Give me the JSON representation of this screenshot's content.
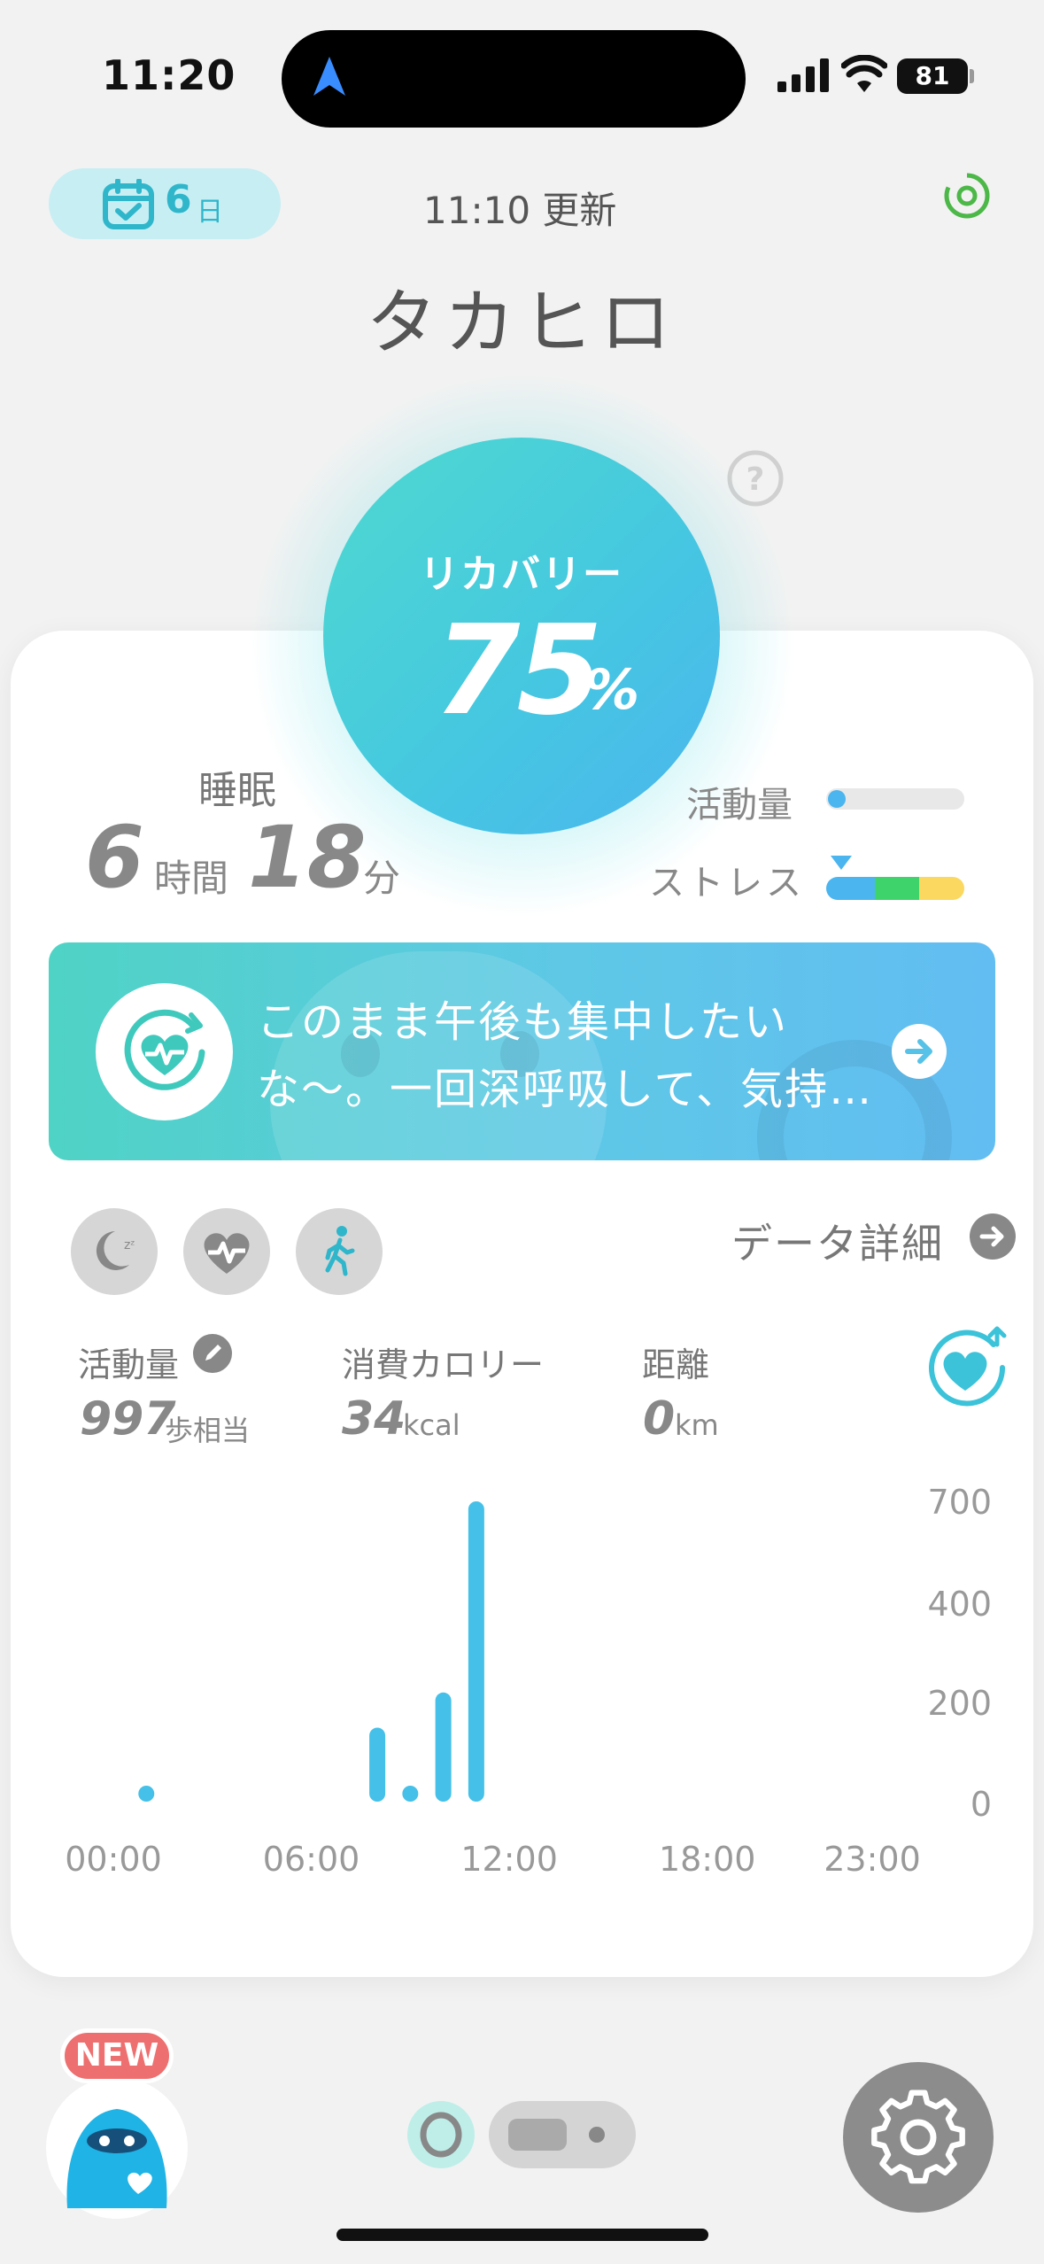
{
  "status_bar": {
    "time": "11:20",
    "battery": "81"
  },
  "header": {
    "days_count": "6",
    "days_unit": "日",
    "updated": "11:10 更新",
    "user_name": "タカヒロ"
  },
  "recovery": {
    "label": "リカバリー",
    "value": "75",
    "unit": "%"
  },
  "sleep": {
    "label": "睡眠",
    "hours": "6",
    "hours_unit": "時間",
    "minutes": "18",
    "minutes_unit": "分"
  },
  "indicators": {
    "activity_label": "活動量",
    "activity_level": 0.05,
    "stress_label": "ストレス",
    "stress_colors": [
      "#4bb5ef",
      "#3fd36b",
      "#fbd860"
    ]
  },
  "banner": {
    "message": "このまま午後も集中したいな〜。一回深呼吸して、気持…"
  },
  "tabs": [
    "sleep",
    "heart",
    "activity"
  ],
  "details": {
    "label": "データ詳細"
  },
  "metrics": [
    {
      "label": "活動量",
      "value": "997",
      "unit": "歩相当"
    },
    {
      "label": "消費カロリー",
      "value": "34",
      "unit": "kcal"
    },
    {
      "label": "距離",
      "value": "0",
      "unit": "km"
    }
  ],
  "chart_data": {
    "type": "bar",
    "x_ticks": [
      "00:00",
      "06:00",
      "12:00",
      "18:00",
      "23:00"
    ],
    "y_ticks": [
      0,
      200,
      400,
      700
    ],
    "x_range_hours": [
      0,
      23
    ],
    "points": [
      {
        "hour": 1.0,
        "value": 5
      },
      {
        "hour": 8.0,
        "value": 150
      },
      {
        "hour": 9.0,
        "value": 10
      },
      {
        "hour": 10.0,
        "value": 220
      },
      {
        "hour": 11.0,
        "value": 700
      }
    ],
    "bar_color": "#45c0e8"
  },
  "bottom": {
    "new_badge": "NEW"
  },
  "colors": {
    "accent": "#45c8e0",
    "teal": "#4fd9cf",
    "badge_red": "#ee6f6f"
  }
}
